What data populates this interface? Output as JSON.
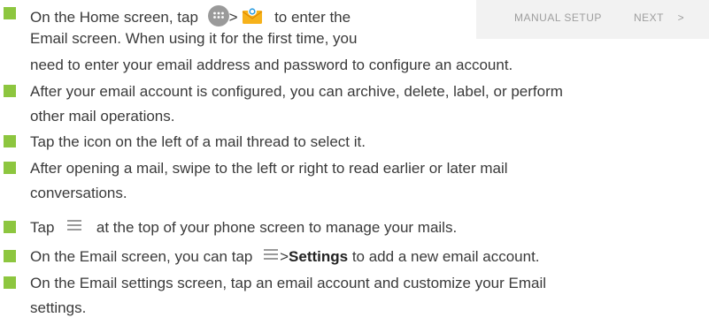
{
  "accent_color": "#8dc63f",
  "setup_bar": {
    "manual_setup_label": "MANUAL SETUP",
    "next_label": "NEXT",
    "next_icon": "chevron-right-icon",
    "next_glyph": ">"
  },
  "items": [
    {
      "line1_before": "On the Home screen, tap",
      "apps_icon": "apps-icon",
      "sep": ">",
      "email_icon": "email-app-icon",
      "line1_after": "to enter the",
      "line2": "Email screen. When using it for the first time, you",
      "line3": "need to enter your email address and password to configure an account."
    },
    {
      "line1": "After your email account is configured, you can archive, delete, label, or perform",
      "line2": "other mail operations."
    },
    {
      "line1": "Tap the icon on the left of a mail thread to select it."
    },
    {
      "line1": "After opening a mail, swipe to the left or right to read earlier or later mail",
      "line2": "conversations."
    },
    {
      "before": "Tap",
      "menu_icon": "menu-icon",
      "after": "at the top of your phone screen to manage your mails."
    },
    {
      "before": "On the Email screen, you can tap",
      "menu_icon": "menu-icon",
      "sep": ">",
      "bold": "Settings",
      "after": "to add a new email account."
    },
    {
      "line1": "On the Email settings screen, tap an email account and customize your Email",
      "line2": "settings."
    }
  ]
}
